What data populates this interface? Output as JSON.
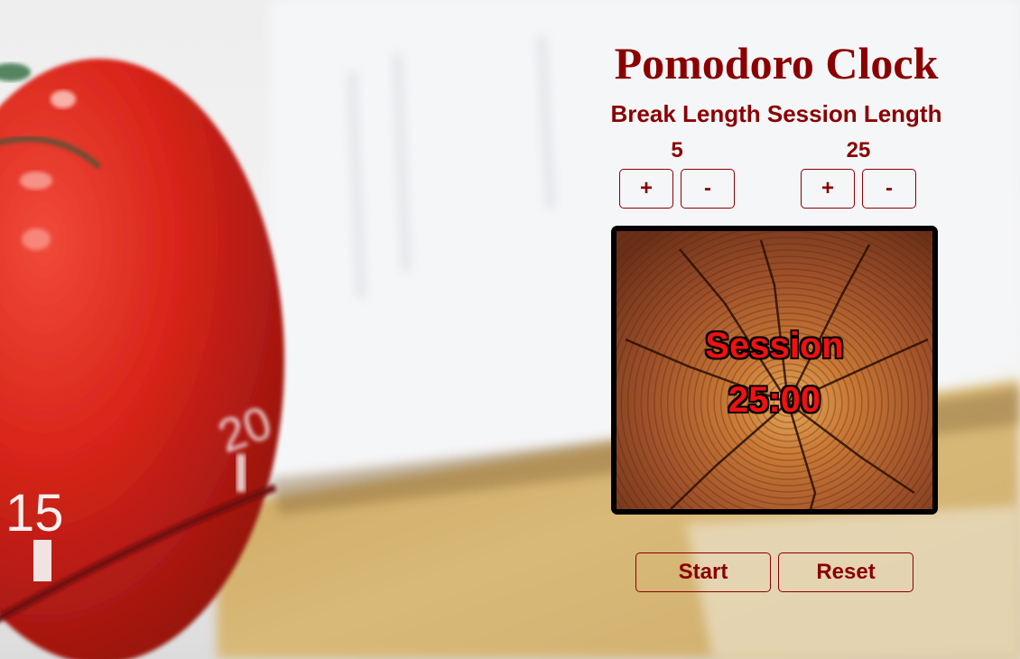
{
  "app": {
    "title": "Pomodoro Clock",
    "lengths_heading": "Break Length Session Length",
    "break_length": "5",
    "session_length": "25",
    "break_increment_label": "+",
    "break_decrement_label": "-",
    "session_increment_label": "+",
    "session_decrement_label": "-",
    "timer_label": "Session",
    "timer_time": "25:00",
    "start_label": "Start",
    "reset_label": "Reset"
  },
  "background": {
    "dial_numbers": [
      "20",
      "15"
    ]
  },
  "colors": {
    "accent": "#8b0000",
    "timer_text": "#ee1111",
    "timer_border": "#000000"
  }
}
